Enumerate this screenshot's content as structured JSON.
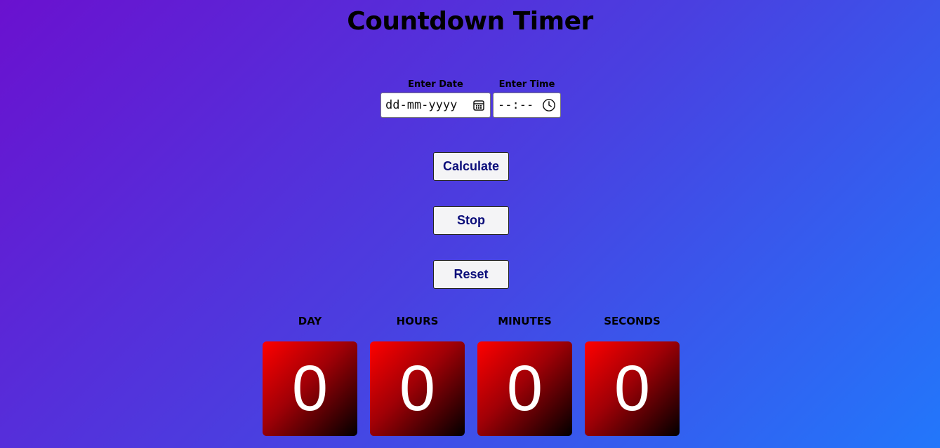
{
  "header": {
    "title": "Countdown Timer"
  },
  "inputs": {
    "date": {
      "label": "Enter Date",
      "value": "dd-mm-yyyy",
      "icon": "calendar-icon"
    },
    "time": {
      "label": "Enter Time",
      "value": "--:--",
      "icon": "clock-icon"
    }
  },
  "buttons": {
    "calculate": "Calculate",
    "stop": "Stop",
    "reset": "Reset"
  },
  "countdown": [
    {
      "label": "DAY",
      "value": "0"
    },
    {
      "label": "HOURS",
      "value": "0"
    },
    {
      "label": "MINUTES",
      "value": "0"
    },
    {
      "label": "SECONDS",
      "value": "0"
    }
  ],
  "colors": {
    "button_text": "#0b0e7a",
    "tile_start": "#ff0000",
    "tile_end": "#000000"
  }
}
